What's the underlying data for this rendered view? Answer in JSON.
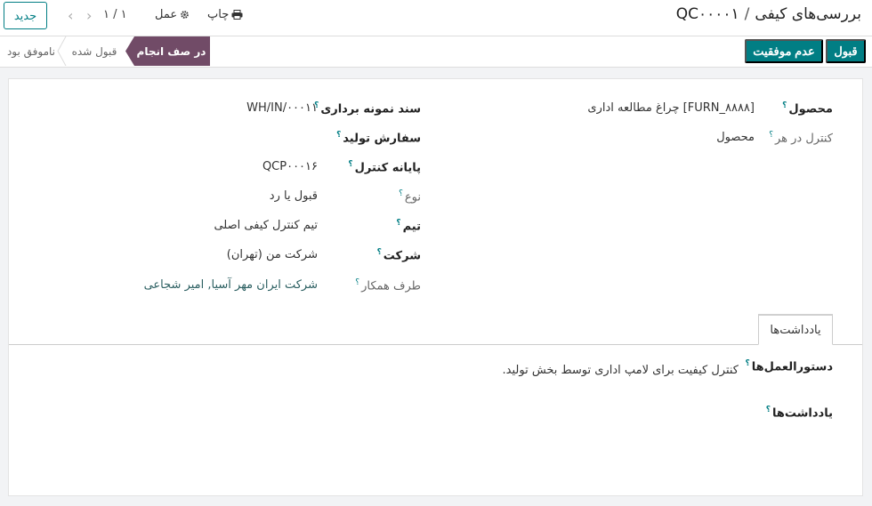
{
  "breadcrumb": {
    "parent": "بررسی‌های کیفی",
    "separator": "/",
    "current": "QC۰۰۰۰۱"
  },
  "toolbar": {
    "print_label": "چاپ",
    "action_label": "عمل",
    "new_label": "جدید"
  },
  "pager": {
    "value": "۱ / ۱"
  },
  "status_buttons": {
    "pass_label": "قبول",
    "fail_label": "عدم موفقیت"
  },
  "stages": [
    {
      "label": "در صف انجام",
      "active": true
    },
    {
      "label": "قبول شده",
      "active": false
    },
    {
      "label": "ناموفق بود",
      "active": false
    }
  ],
  "fields_right": [
    {
      "label": "محصول",
      "value": "[FURN_۸۸۸۸] چراغ مطالعه اداری",
      "bold": true
    },
    {
      "label": "کنترل در هر",
      "value": "محصول",
      "bold": false
    }
  ],
  "fields_left": [
    {
      "label": "سند نمونه برداری",
      "value": "WH/IN/۰۰۰۱۱",
      "bold": true
    },
    {
      "label": "سفارش تولید",
      "value": "",
      "bold": true
    },
    {
      "label": "پایانه کنترل",
      "value": "QCP۰۰۰۱۶",
      "bold": true
    },
    {
      "label": "نوع",
      "value": "قبول یا رد",
      "bold": false
    },
    {
      "label": "تیم",
      "value": "تیم کنترل کیفی اصلی",
      "bold": true
    },
    {
      "label": "شرکت",
      "value": "شرکت من (تهران)",
      "bold": true
    },
    {
      "label": "طرف همکار",
      "value": "شرکت ایران مهر آسیا, امیر شجاعی",
      "bold": false
    }
  ],
  "tabs": [
    {
      "label": "یادداشت‌ها",
      "active": true
    }
  ],
  "notes": {
    "instructions_label": "دستورالعمل‌ها",
    "instructions_value": "کنترل کیفیت برای لامپ اداری توسط بخش تولید.",
    "notes_label": "یادداشت‌ها",
    "help_mark": "؟"
  },
  "colors": {
    "primary": "#017e84",
    "active_stage": "#714b67"
  }
}
